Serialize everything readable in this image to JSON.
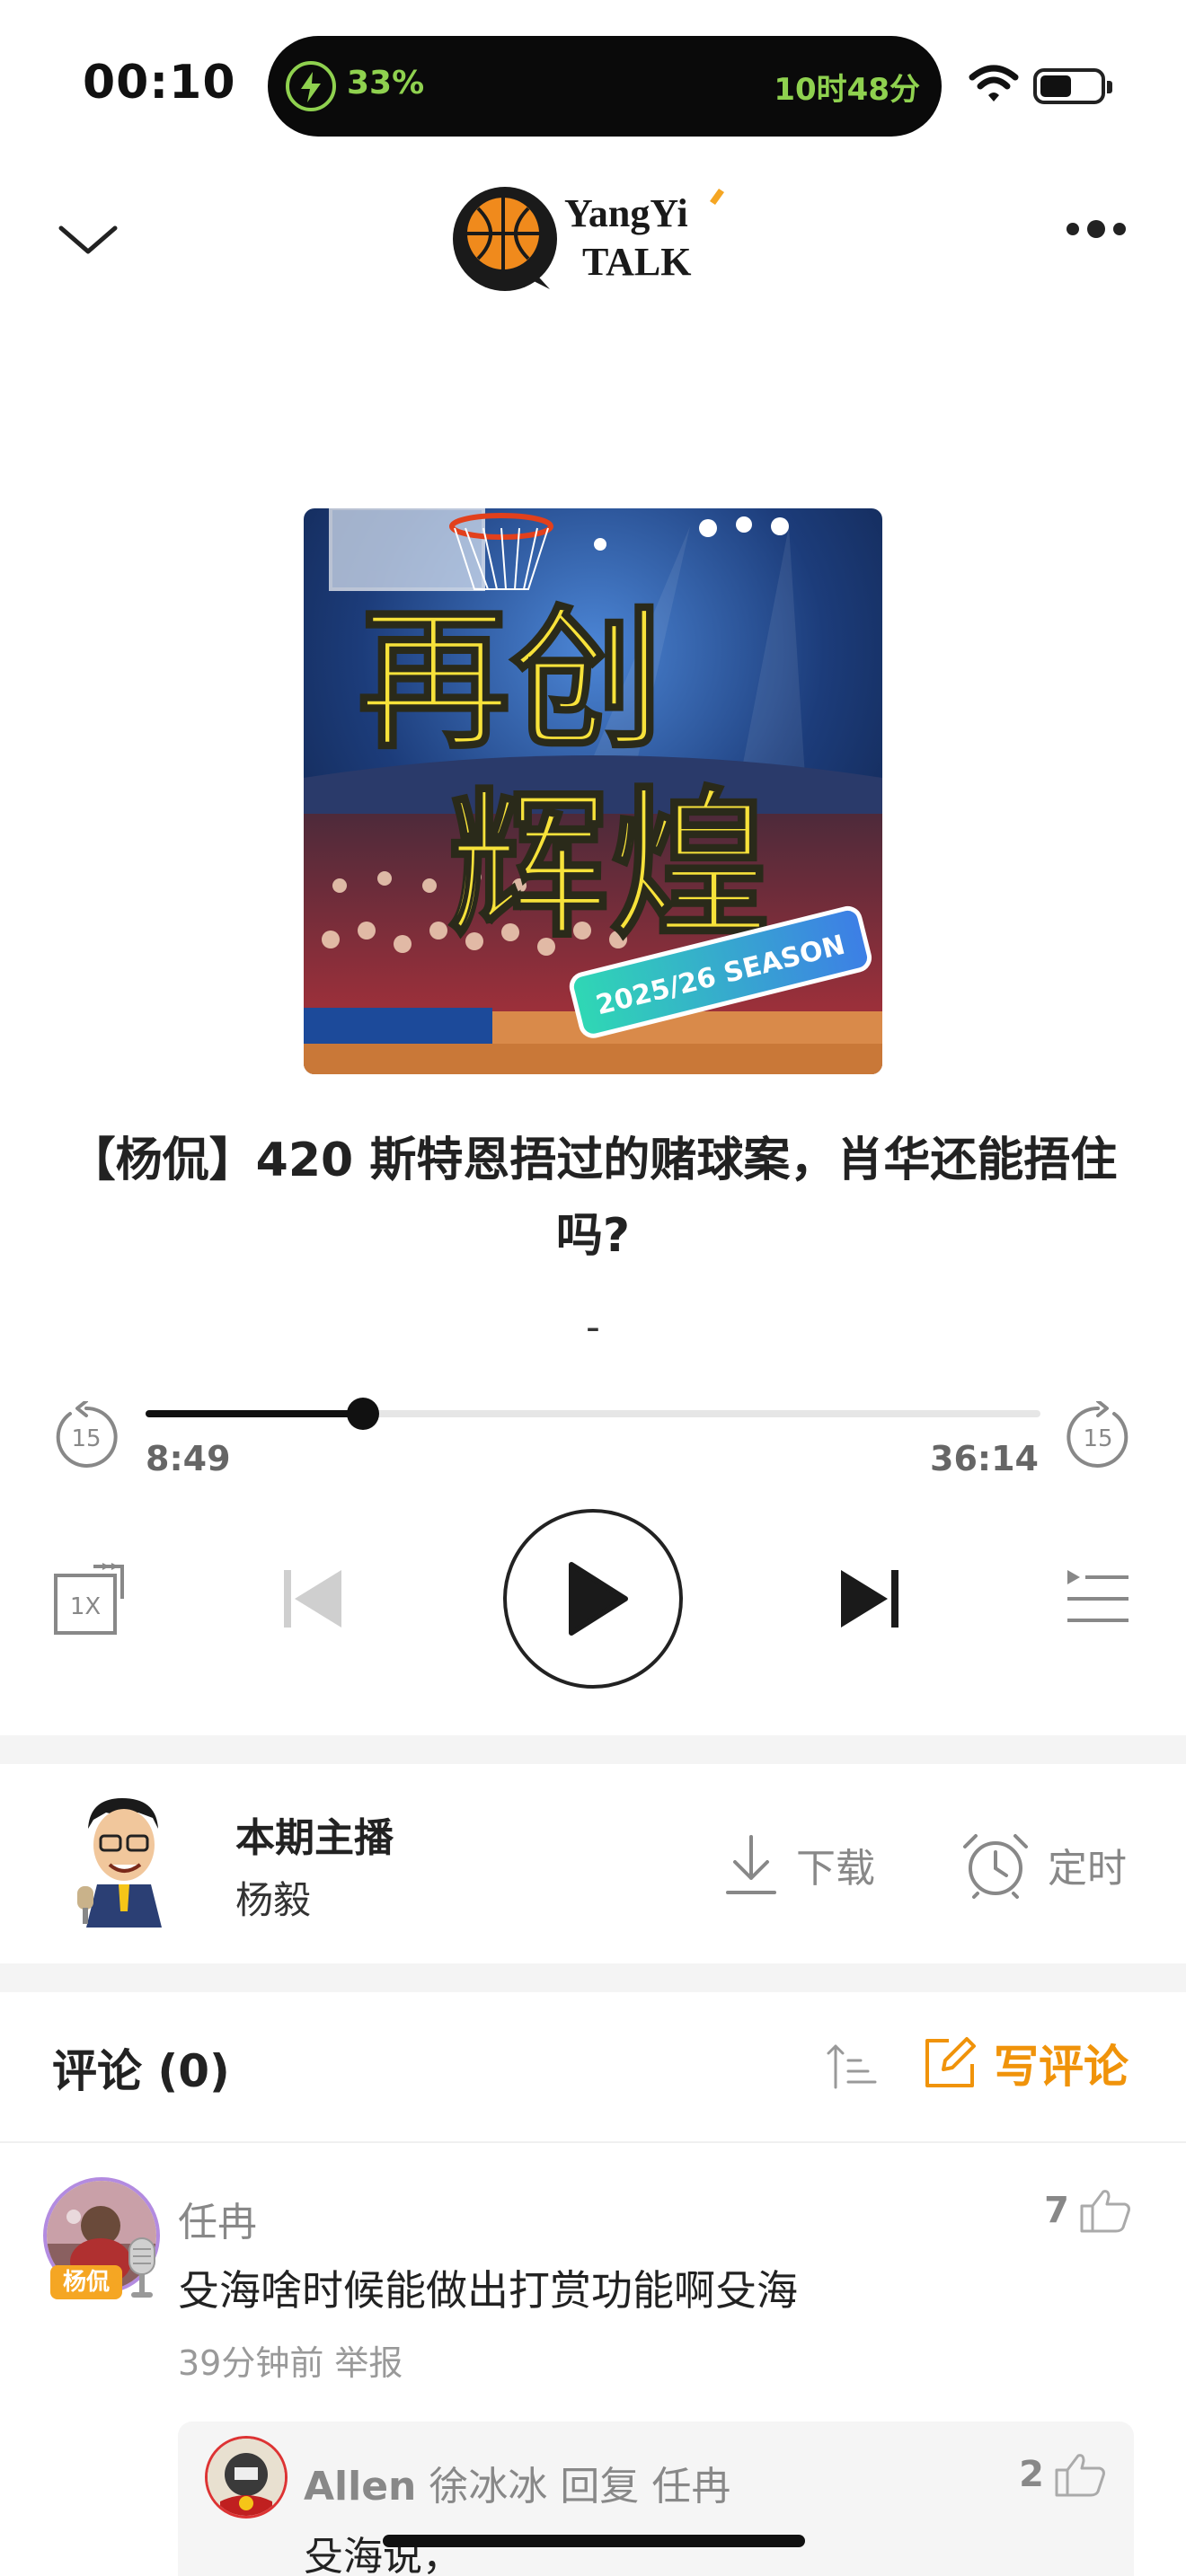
{
  "status_bar": {
    "time": "00:10",
    "battery_percent": "33%",
    "battery_remaining": "10时48分"
  },
  "header": {
    "back_icon": "chevron-down-icon",
    "logo_text_1": "YangYi",
    "logo_text_2": "TALK",
    "more_icon": "more-dots-icon"
  },
  "cover": {
    "line1": "再创",
    "line2": "辉煌",
    "ribbon": "2025/26 SEASON"
  },
  "episode": {
    "title": "【杨侃】420 斯特恩捂过的赌球案，肖华还能捂住吗?",
    "subtitle": "-"
  },
  "progress": {
    "current_time": "8:49",
    "duration": "36:14",
    "fraction": 0.243,
    "skip_back": "15",
    "skip_forward": "15"
  },
  "controls": {
    "speed": "1X"
  },
  "host": {
    "label": "本期主播",
    "name": "杨毅",
    "download_label": "下载",
    "timer_label": "定时"
  },
  "comments": {
    "header": "评论 (0)",
    "write_label": "写评论",
    "items": [
      {
        "user": "任冉",
        "badge": "杨侃",
        "text": "殳海啥时候能做出打赏功能啊殳海",
        "meta": "39分钟前  举报",
        "likes": "7",
        "reply": {
          "user_en": "Allen",
          "user_cn": "徐冰冰",
          "reply_word": "回复",
          "reply_to": "任冉",
          "text": "殳海说，",
          "likes": "2"
        }
      }
    ]
  },
  "colors": {
    "accent": "#f0930a",
    "island_text": "#8fd14f",
    "cover_yellow": "#f7e23a"
  }
}
